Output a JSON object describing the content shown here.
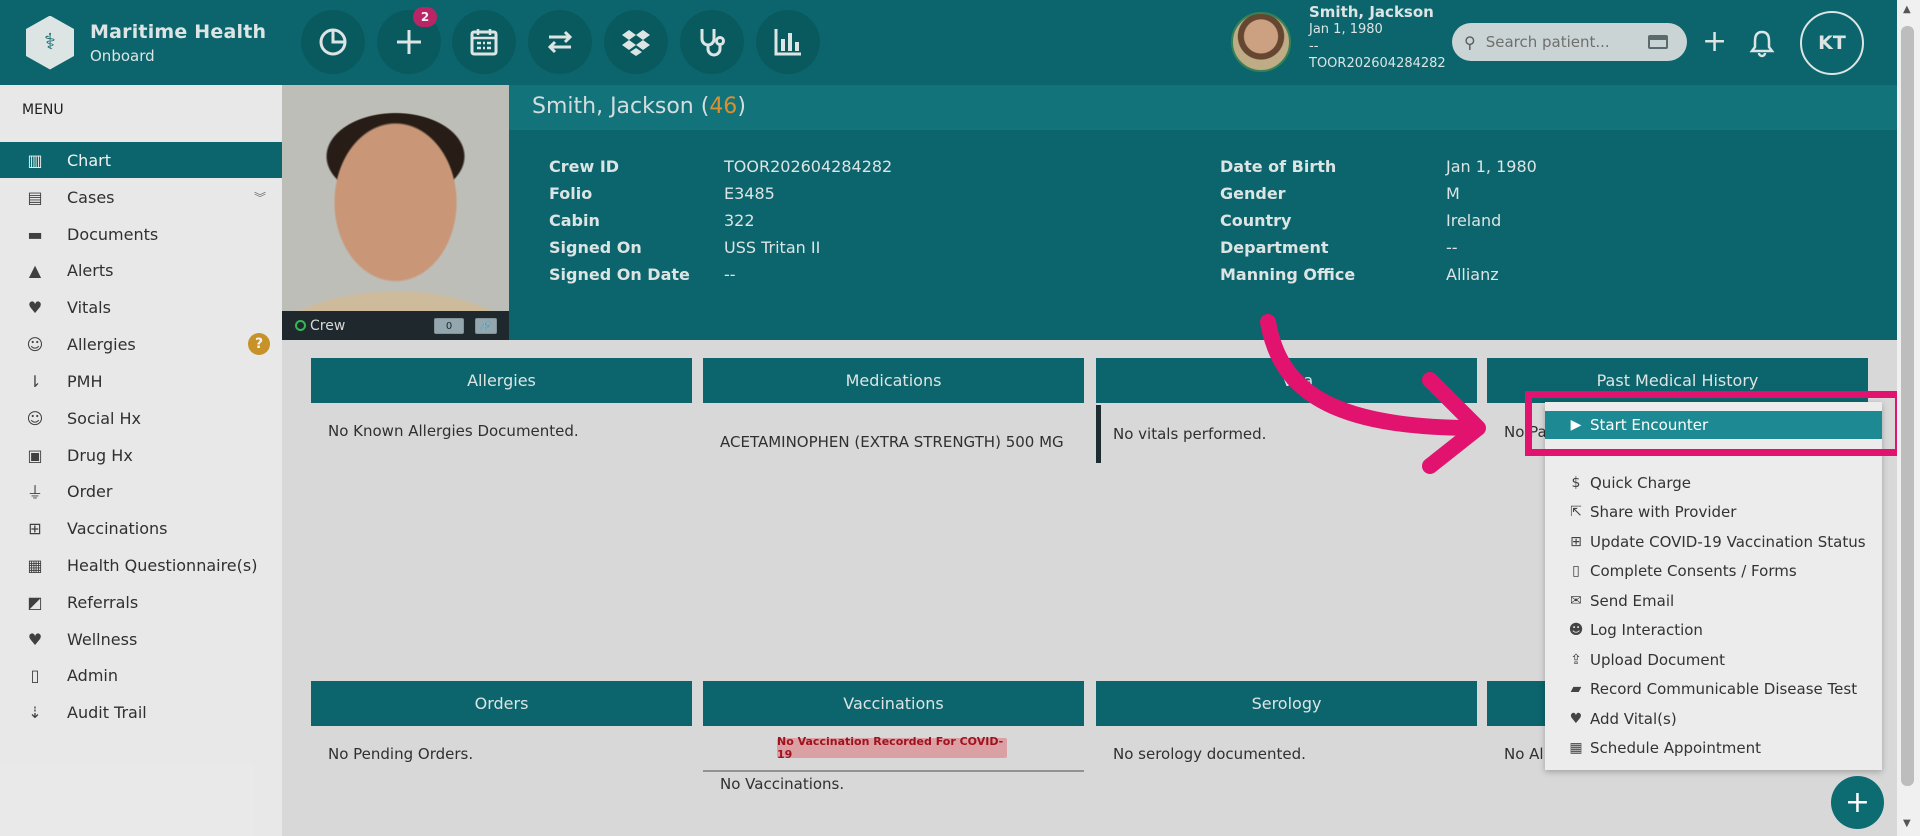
{
  "brand": {
    "name": "Maritime Health",
    "sub": "Onboard"
  },
  "toolbar": {
    "badge_count": "2"
  },
  "header_patient": {
    "name": "Smith, Jackson",
    "dob": "Jan 1, 1980",
    "extra": "--",
    "crew_id": "TOOR202604284282"
  },
  "search": {
    "placeholder": "Search patient..."
  },
  "user": {
    "initials": "KT"
  },
  "sidebar": {
    "title": "MENU",
    "items": [
      {
        "label": "Chart",
        "icon": "chart-icon"
      },
      {
        "label": "Cases",
        "icon": "case-icon"
      },
      {
        "label": "Documents",
        "icon": "folder-icon"
      },
      {
        "label": "Alerts",
        "icon": "warning-icon"
      },
      {
        "label": "Vitals",
        "icon": "heart-icon"
      },
      {
        "label": "Allergies",
        "icon": "smile-icon"
      },
      {
        "label": "PMH",
        "icon": "sort-icon"
      },
      {
        "label": "Social Hx",
        "icon": "smile-icon"
      },
      {
        "label": "Drug Hx",
        "icon": "medkit-icon"
      },
      {
        "label": "Order",
        "icon": "flask-icon"
      },
      {
        "label": "Vaccinations",
        "icon": "plus-square-icon"
      },
      {
        "label": "Health Questionnaire(s)",
        "icon": "list-icon"
      },
      {
        "label": "Referrals",
        "icon": "share-icon"
      },
      {
        "label": "Wellness",
        "icon": "heartbeat-icon"
      },
      {
        "label": "Admin",
        "icon": "file-icon"
      },
      {
        "label": "Audit Trail",
        "icon": "sort-numeric-icon"
      }
    ]
  },
  "patient": {
    "name": "Smith, Jackson",
    "age": "46",
    "status": "Crew",
    "chip1": "0",
    "left_fields": [
      {
        "key": "Crew ID",
        "value": "TOOR202604284282"
      },
      {
        "key": "Folio",
        "value": "E3485"
      },
      {
        "key": "Cabin",
        "value": "322"
      },
      {
        "key": "Signed On",
        "value": "USS Tritan II"
      },
      {
        "key": "Signed On Date",
        "value": "--"
      }
    ],
    "right_fields": [
      {
        "key": "Date of Birth",
        "value": "Jan 1, 1980"
      },
      {
        "key": "Gender",
        "value": "M"
      },
      {
        "key": "Country",
        "value": "Ireland"
      },
      {
        "key": "Department",
        "value": "--"
      },
      {
        "key": "Manning Office",
        "value": "Allianz"
      }
    ]
  },
  "cards": {
    "allergies": {
      "title": "Allergies",
      "text": "No Known Allergies Documented."
    },
    "medications": {
      "title": "Medications",
      "text": "ACETAMINOPHEN (EXTRA STRENGTH) 500 MG"
    },
    "vitals": {
      "title": "Vita",
      "text": "No vitals performed."
    },
    "pmh": {
      "title": "Past Medical History",
      "text": "No Pa"
    },
    "orders": {
      "title": "Orders",
      "text": "No Pending Orders."
    },
    "vaccinations": {
      "title": "Vaccinations",
      "badge": "No Vaccination Recorded For COVID-19",
      "text": "No Vaccinations."
    },
    "serology": {
      "title": "Serology",
      "text": "No serology documented."
    },
    "fourth": {
      "title": "",
      "text": "No Al"
    }
  },
  "dropdown": {
    "highlighted": {
      "label": "Start Encounter",
      "icon": "play-circle-icon"
    },
    "items": [
      {
        "label": "Quick Charge",
        "icon": "dollar-icon"
      },
      {
        "label": "Share with Provider",
        "icon": "share-icon"
      },
      {
        "label": "Update COVID-19 Vaccination Status",
        "icon": "plus-square-icon"
      },
      {
        "label": "Complete Consents / Forms",
        "icon": "file-icon"
      },
      {
        "label": "Send Email",
        "icon": "envelope-icon"
      },
      {
        "label": "Log Interaction",
        "icon": "users-icon"
      },
      {
        "label": "Upload Document",
        "icon": "upload-icon"
      },
      {
        "label": "Record Communicable Disease Test",
        "icon": "ambulance-icon"
      },
      {
        "label": "Add Vital(s)",
        "icon": "heart-icon"
      },
      {
        "label": "Schedule Appointment",
        "icon": "calendar-icon"
      }
    ]
  },
  "colors": {
    "primary": "#0d6b72",
    "accent": "#e1136f",
    "age": "#e39a32",
    "badge": "#c4286b"
  }
}
